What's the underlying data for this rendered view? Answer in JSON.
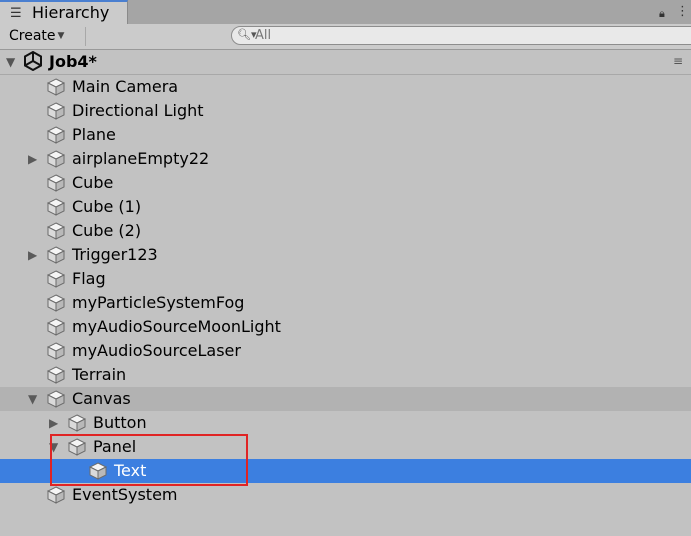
{
  "tab": {
    "icon": "hierarchy-list-icon",
    "label": "Hierarchy"
  },
  "toolbar": {
    "create_label": "Create",
    "search_placeholder": "All"
  },
  "scene": {
    "name": "Job4*"
  },
  "items": [
    {
      "label": "Main Camera",
      "depth": 0,
      "expander": "none"
    },
    {
      "label": "Directional Light",
      "depth": 0,
      "expander": "none"
    },
    {
      "label": "Plane",
      "depth": 0,
      "expander": "none"
    },
    {
      "label": "airplaneEmpty22",
      "depth": 0,
      "expander": "collapsed"
    },
    {
      "label": "Cube",
      "depth": 0,
      "expander": "none"
    },
    {
      "label": "Cube (1)",
      "depth": 0,
      "expander": "none"
    },
    {
      "label": "Cube (2)",
      "depth": 0,
      "expander": "none"
    },
    {
      "label": "Trigger123",
      "depth": 0,
      "expander": "collapsed"
    },
    {
      "label": "Flag",
      "depth": 0,
      "expander": "none"
    },
    {
      "label": "myParticleSystemFog",
      "depth": 0,
      "expander": "none"
    },
    {
      "label": "myAudioSourceMoonLight",
      "depth": 0,
      "expander": "none"
    },
    {
      "label": "myAudioSourceLaser",
      "depth": 0,
      "expander": "none"
    },
    {
      "label": "Terrain",
      "depth": 0,
      "expander": "none"
    },
    {
      "label": "Canvas",
      "depth": 0,
      "expander": "expanded"
    },
    {
      "label": "Button",
      "depth": 1,
      "expander": "collapsed"
    },
    {
      "label": "Panel",
      "depth": 1,
      "expander": "expanded"
    },
    {
      "label": "Text",
      "depth": 2,
      "expander": "none",
      "selected": true
    },
    {
      "label": "EventSystem",
      "depth": 0,
      "expander": "none"
    }
  ],
  "colors": {
    "selection": "#3c7fe0",
    "highlight_box": "#e02424"
  }
}
